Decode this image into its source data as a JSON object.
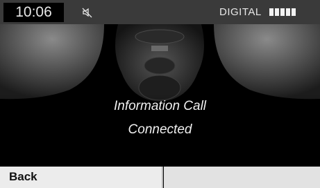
{
  "status": {
    "time": "10:06",
    "mute_icon": "speaker-muted-icon",
    "reception_label": "DIGITAL",
    "signal_bars": 5
  },
  "message": {
    "line1": "Information Call",
    "line2": "Connected"
  },
  "softkeys": {
    "left_label": "Back",
    "right_label": ""
  }
}
